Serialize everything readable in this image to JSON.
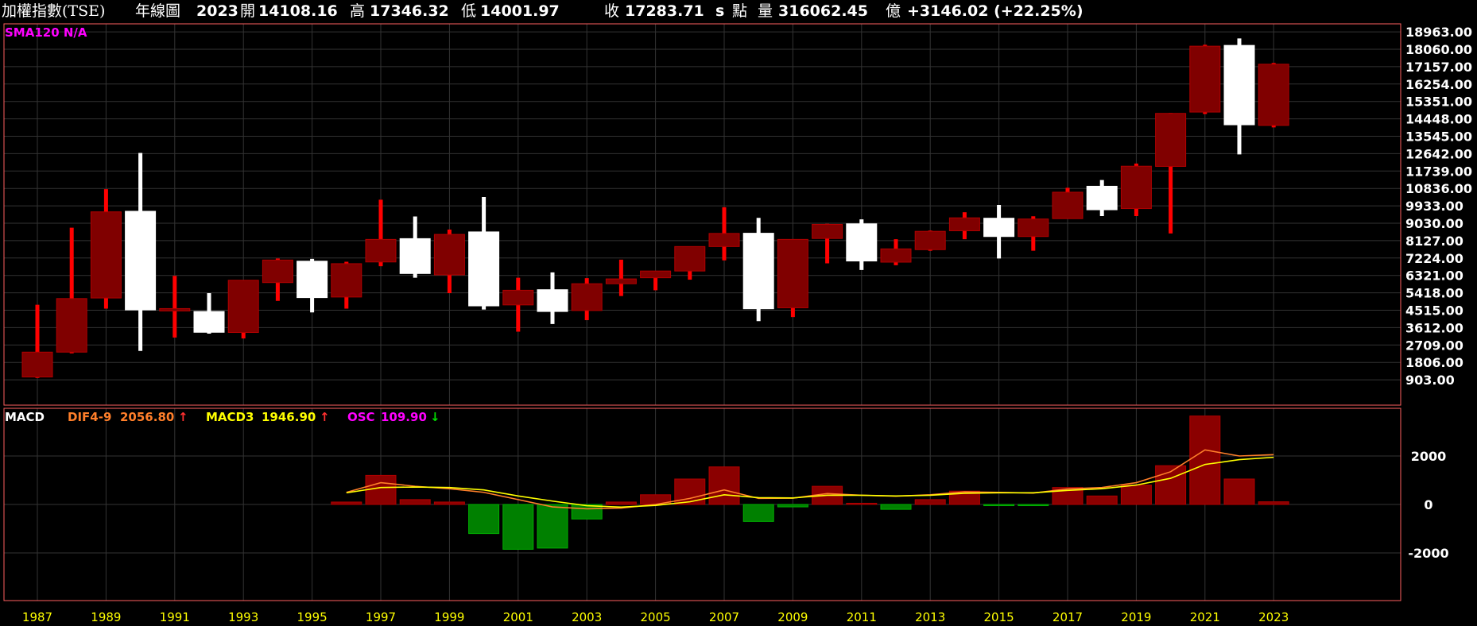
{
  "header": {
    "name": "加權指數(TSE)",
    "period": "年線圖",
    "year": "2023",
    "open_label": "開",
    "open": "14108.16",
    "high_label": "高",
    "high": "17346.32",
    "low_label": "低",
    "low": "14001.97",
    "close_label": "收",
    "close": "17283.71",
    "s_label": "s",
    "unit_label": "點",
    "volume_label": "量",
    "volume": "316062.45",
    "volume_unit": "億",
    "change": "+3146.02 (+22.25%)"
  },
  "colors": {
    "background": "#000000",
    "up": "#800000",
    "up_wick": "#ff0000",
    "down": "#ffffff",
    "grid": "#333333",
    "axis_text": "#ffff00",
    "border": "#ff6060",
    "dif": "#ff7f2a",
    "macd": "#ffff00",
    "osc_pos": "#8b0000",
    "osc_neg": "#008000",
    "sma_label": "#ff00ff"
  },
  "chart_data": [
    {
      "type": "candlestick",
      "indicator_label": "SMA120 N/A",
      "x": [
        1987,
        1988,
        1989,
        1990,
        1991,
        1992,
        1993,
        1994,
        1995,
        1996,
        1997,
        1998,
        1999,
        2000,
        2001,
        2002,
        2003,
        2004,
        2005,
        2006,
        2007,
        2008,
        2009,
        2010,
        2011,
        2012,
        2013,
        2014,
        2015,
        2016,
        2017,
        2018,
        2019,
        2020,
        2021,
        2022,
        2023
      ],
      "open": [
        1050,
        2340,
        5150,
        9650,
        4500,
        4450,
        3360,
        5950,
        7060,
        5200,
        7020,
        8230,
        6350,
        8580,
        4790,
        5580,
        4500,
        5890,
        6200,
        6550,
        7820,
        8510,
        4640,
        8240,
        9000,
        7010,
        7660,
        8640,
        9290,
        8340,
        9270,
        10950,
        9790,
        11980,
        14800,
        18260,
        14108.16
      ],
      "high": [
        4800,
        8800,
        10800,
        12680,
        6300,
        5400,
        5990,
        7200,
        7180,
        7030,
        10250,
        9380,
        8700,
        10390,
        6200,
        6480,
        6180,
        7140,
        6480,
        7760,
        9860,
        9310,
        8180,
        9000,
        9230,
        8200,
        8650,
        9600,
        9980,
        9390,
        10870,
        11270,
        12130,
        14750,
        18290,
        18620,
        17346.32
      ],
      "low": [
        1000,
        2280,
        4600,
        2400,
        3100,
        3300,
        3050,
        5000,
        4400,
        4600,
        6800,
        6200,
        5400,
        4550,
        3400,
        3800,
        4000,
        5250,
        5550,
        6100,
        7100,
        3950,
        4160,
        6950,
        6600,
        6850,
        7600,
        8200,
        7200,
        7600,
        9300,
        9400,
        9400,
        8500,
        14700,
        12600,
        14001.97
      ],
      "close": [
        2340,
        5120,
        9620,
        4530,
        4600,
        3370,
        6070,
        7120,
        5170,
        6930,
        8190,
        6420,
        8450,
        4740,
        5550,
        4450,
        5890,
        6140,
        6550,
        7820,
        8500,
        4590,
        8190,
        8970,
        7070,
        7700,
        8610,
        9310,
        8340,
        9250,
        10640,
        9730,
        11990,
        14730,
        18220,
        14140,
        17283.71
      ],
      "ylim": [
        0,
        19400
      ],
      "y_ticks": [
        "903.00",
        "1806.00",
        "2709.00",
        "3612.00",
        "4515.00",
        "5418.00",
        "6321.00",
        "7224.00",
        "8127.00",
        "9030.00",
        "9933.00",
        "10836.00",
        "11739.00",
        "12642.00",
        "13545.00",
        "14448.00",
        "15351.00",
        "16254.00",
        "17157.00",
        "18060.00",
        "18963.00"
      ],
      "grid": true
    },
    {
      "type": "macd",
      "label": "MACD",
      "dif_label": "DIF4-9",
      "dif_value": "2056.80",
      "dif_arrow": "↑",
      "macd_label": "MACD3",
      "macd_value": "1946.90",
      "macd_arrow": "↑",
      "osc_label": "OSC",
      "osc_value": "109.90",
      "osc_arrow": "↓",
      "x": [
        1996,
        1997,
        1998,
        1999,
        2000,
        2001,
        2002,
        2003,
        2004,
        2005,
        2006,
        2007,
        2008,
        2009,
        2010,
        2011,
        2012,
        2013,
        2014,
        2015,
        2016,
        2017,
        2018,
        2019,
        2020,
        2021,
        2022,
        2023
      ],
      "dif": [
        500,
        900,
        750,
        650,
        500,
        200,
        -100,
        -180,
        -150,
        0,
        250,
        600,
        250,
        260,
        450,
        380,
        340,
        400,
        520,
        500,
        470,
        640,
        700,
        900,
        1350,
        2250,
        2000,
        2056.8
      ],
      "macd": [
        480,
        700,
        720,
        700,
        600,
        350,
        140,
        -50,
        -110,
        -40,
        110,
        400,
        280,
        270,
        380,
        380,
        350,
        380,
        460,
        480,
        480,
        580,
        650,
        800,
        1080,
        1650,
        1850,
        1946.9
      ],
      "osc": [
        100,
        1200,
        200,
        100,
        -1200,
        -1850,
        -1800,
        -600,
        100,
        400,
        1050,
        1550,
        -700,
        -100,
        750,
        50,
        -200,
        200,
        550,
        -50,
        -50,
        700,
        350,
        800,
        1600,
        3650,
        1050,
        109.9
      ],
      "ylim": [
        -4000,
        3700
      ],
      "y_ticks": [
        "2000",
        "0",
        "-2000"
      ],
      "grid": true
    }
  ],
  "x_axis_labels": [
    "1987",
    "1989",
    "1991",
    "1993",
    "1995",
    "1997",
    "1999",
    "2001",
    "2003",
    "2005",
    "2007",
    "2009",
    "2011",
    "2013",
    "2015",
    "2017",
    "2019",
    "2021",
    "2023"
  ]
}
